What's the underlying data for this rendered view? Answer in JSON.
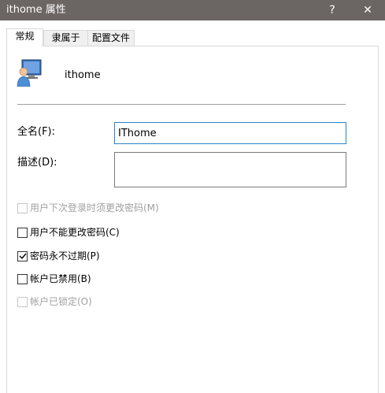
{
  "window": {
    "title": "ithome 属性",
    "help_glyph": "?",
    "close_glyph": "✕",
    "titlebar_color": "#6b6563"
  },
  "tabs": [
    {
      "label": "常规",
      "active": true
    },
    {
      "label": "隶属于",
      "active": false
    },
    {
      "label": "配置文件",
      "active": false
    }
  ],
  "general": {
    "user_icon": "user-monitor-icon",
    "username": "ithome",
    "fullname_label": "全名(F):",
    "fullname_value": "IThome",
    "description_label": "描述(D):",
    "description_value": "",
    "options": [
      {
        "label": "用户下次登录时须更改密码(M)",
        "checked": false,
        "enabled": false
      },
      {
        "label": "用户不能更改密码(C)",
        "checked": false,
        "enabled": true
      },
      {
        "label": "密码永不过期(P)",
        "checked": true,
        "enabled": true
      },
      {
        "label": "帐户已禁用(B)",
        "checked": false,
        "enabled": true
      },
      {
        "label": "帐户已锁定(O)",
        "checked": false,
        "enabled": false
      }
    ]
  },
  "colors": {
    "focus_border": "#2a84c9",
    "disabled_text": "#a0a0a0"
  }
}
